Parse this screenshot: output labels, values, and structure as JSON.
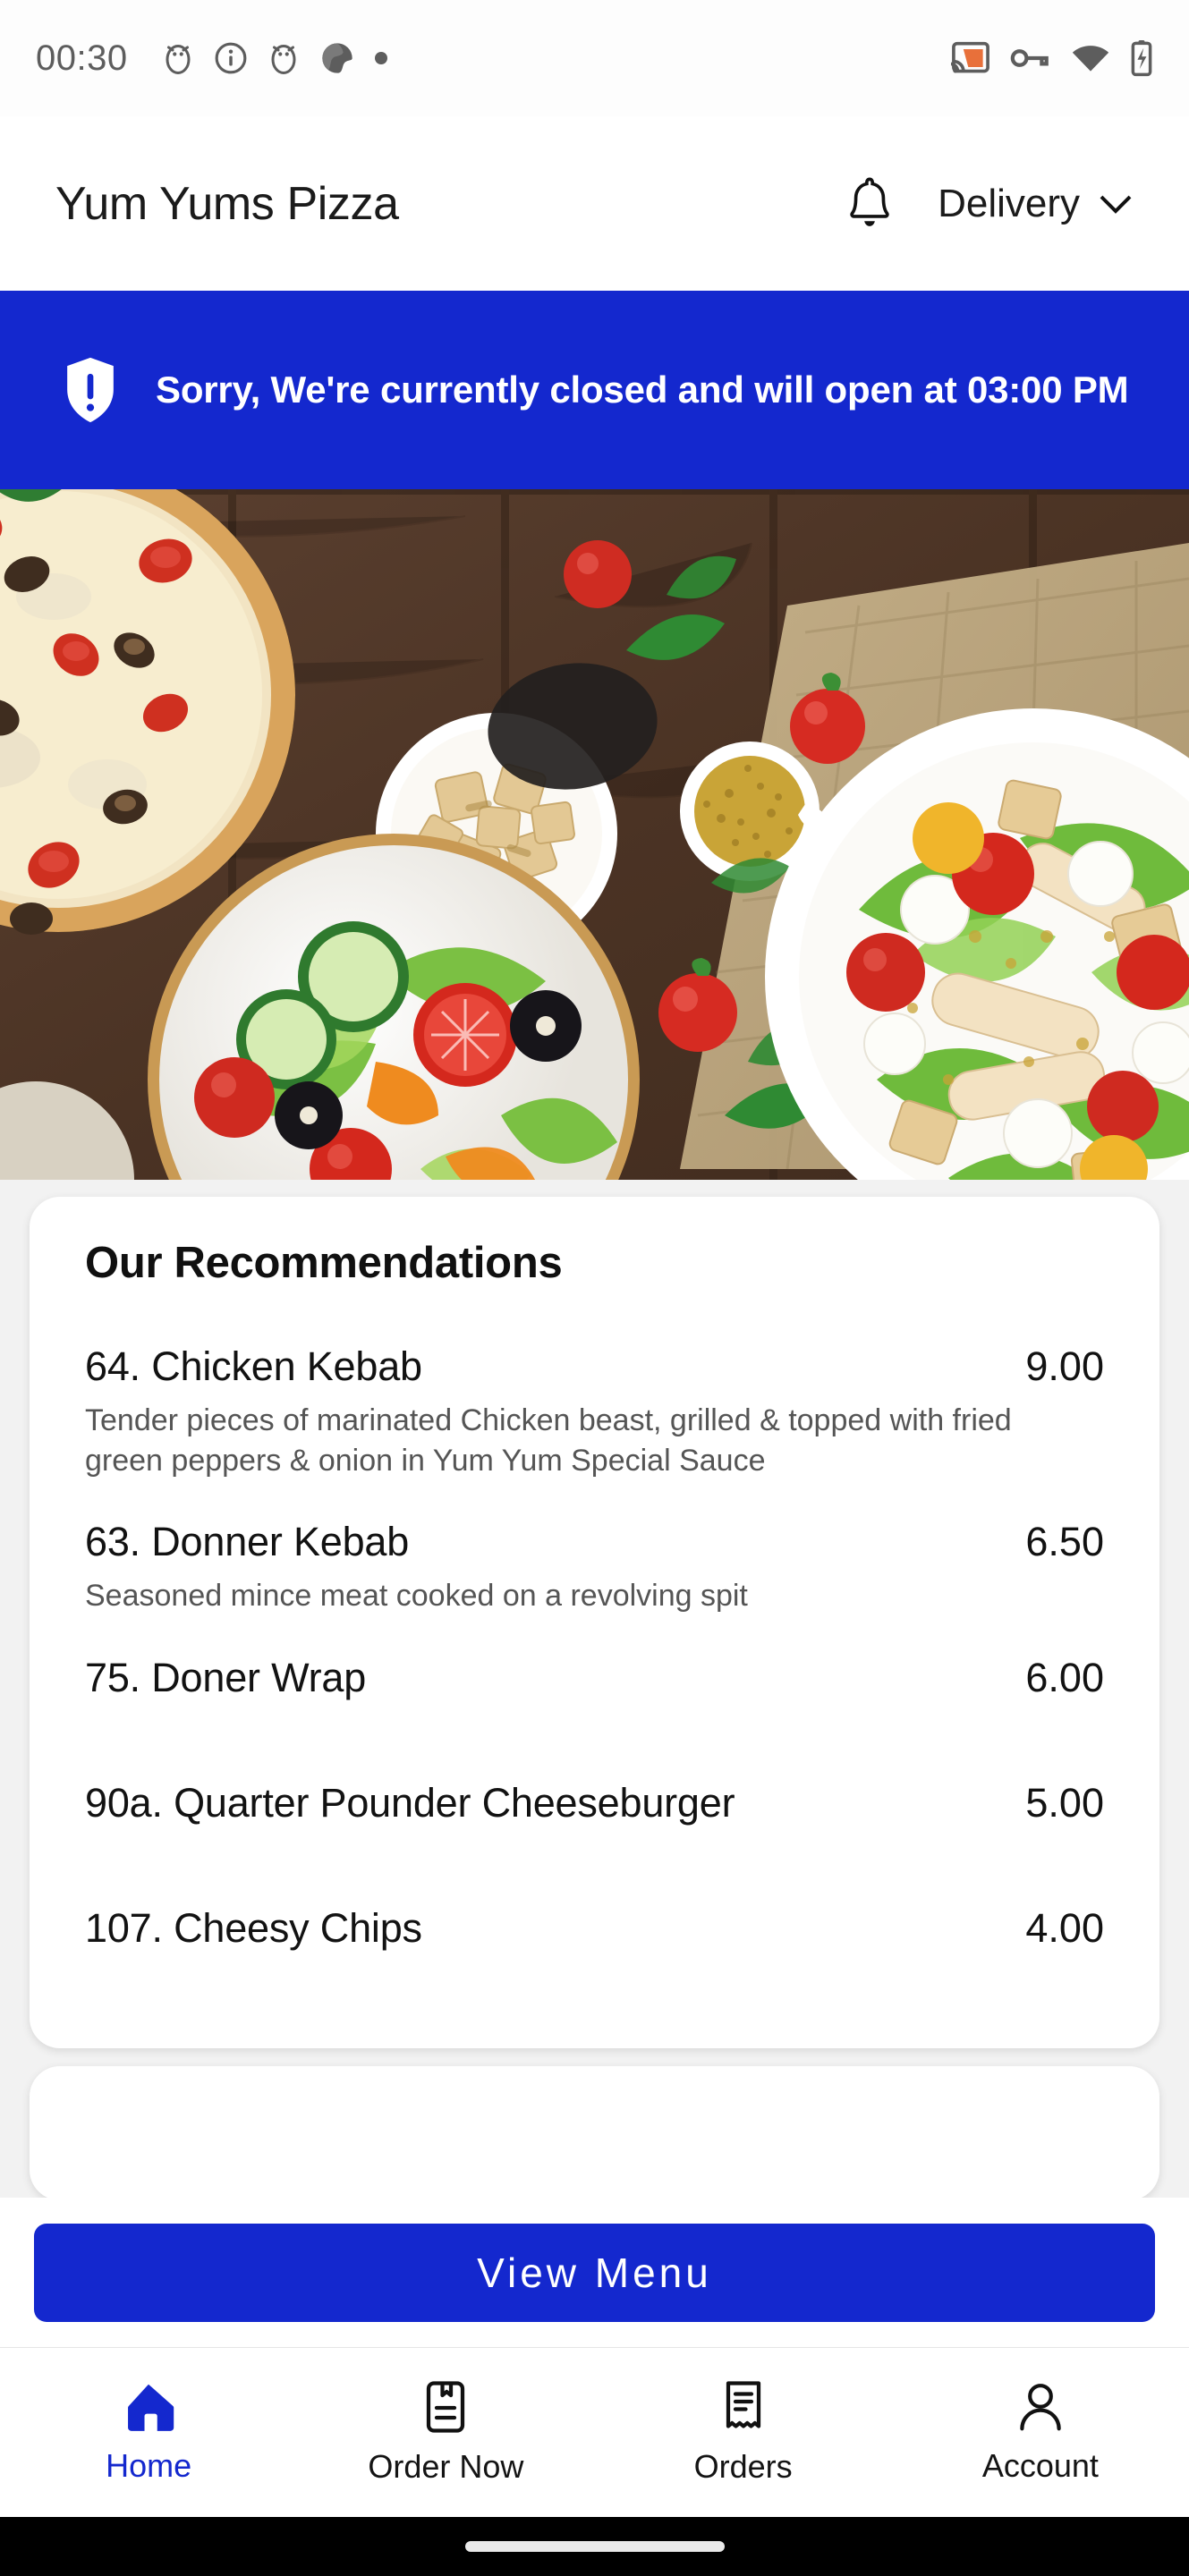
{
  "status_bar": {
    "time": "00:30",
    "left_icons": [
      "alarm-icon",
      "info-icon",
      "alarm-icon",
      "app-logo-icon",
      "dot-icon"
    ],
    "right_icons": [
      "cast-icon",
      "vpn-key-icon",
      "wifi-icon",
      "battery-charging-icon"
    ],
    "cast_color": "#e8703a",
    "icon_color": "#5d5d5d"
  },
  "header": {
    "title": "Yum Yums Pizza",
    "notification_icon": "bell-icon",
    "order_mode": "Delivery",
    "chevron_icon": "chevron-down-icon"
  },
  "banner": {
    "icon": "shield-exclamation-icon",
    "message": "Sorry, We're currently closed and will open at 03:00 PM",
    "background": "#1428ce",
    "text_color": "#ffffff"
  },
  "hero": {
    "alt": "Pizza, greek salad, croutons and dressing on a wooden table"
  },
  "recommendations": {
    "title": "Our Recommendations",
    "items": [
      {
        "name": "64. Chicken Kebab",
        "price": "9.00",
        "description": "Tender pieces of marinated Chicken beast, grilled & topped with fried green peppers & onion in Yum Yum Special Sauce"
      },
      {
        "name": "63. Donner Kebab",
        "price": "6.50",
        "description": "Seasoned mince meat cooked on a revolving spit"
      },
      {
        "name": "75. Doner Wrap",
        "price": "6.00",
        "description": ""
      },
      {
        "name": "90a. Quarter Pounder Cheeseburger",
        "price": "5.00",
        "description": ""
      },
      {
        "name": "107. Cheesy Chips",
        "price": "4.00",
        "description": ""
      }
    ]
  },
  "cta": {
    "view_menu_label": "View Menu",
    "color": "#1428ce"
  },
  "bottom_nav": {
    "active_color": "#1428ce",
    "items": [
      {
        "label": "Home",
        "icon": "home-icon",
        "active": true
      },
      {
        "label": "Order Now",
        "icon": "menu-book-icon",
        "active": false
      },
      {
        "label": "Orders",
        "icon": "receipt-icon",
        "active": false
      },
      {
        "label": "Account",
        "icon": "person-icon",
        "active": false
      }
    ]
  }
}
